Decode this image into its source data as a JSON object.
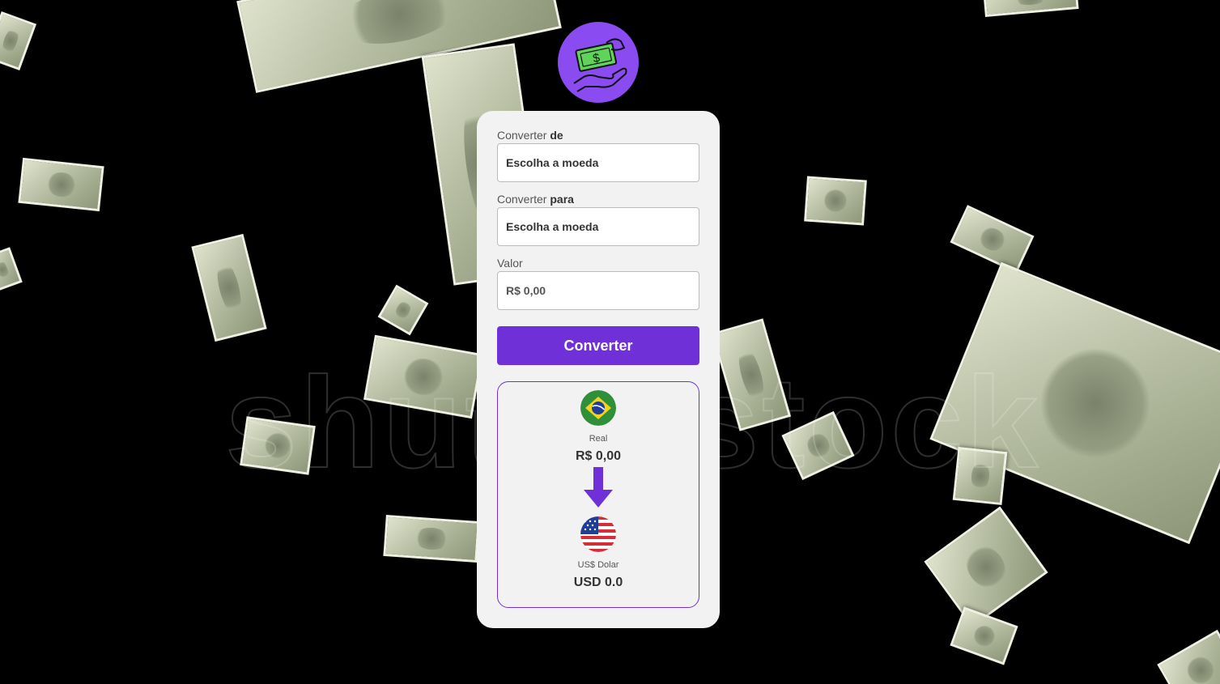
{
  "background": {
    "watermark_text": "shutterstock"
  },
  "logo": {
    "icon": "money-hand-icon",
    "color": "#8a4bf0"
  },
  "form": {
    "from": {
      "label_prefix": "Converter",
      "label_bold": "de",
      "value": "Escolha a moeda"
    },
    "to": {
      "label_prefix": "Converter",
      "label_bold": "para",
      "value": "Escolha a moeda"
    },
    "amount": {
      "label": "Valor",
      "placeholder": "R$ 0,00"
    },
    "convert_button": "Converter"
  },
  "result": {
    "from_currency": {
      "flag": "brazil-flag-icon",
      "name": "Real",
      "value": "R$ 0,00"
    },
    "to_currency": {
      "flag": "usa-flag-icon",
      "name": "US$ Dolar",
      "value": "USD 0.0"
    },
    "arrow_color": "#7030d8"
  },
  "accent_color": "#7030d8"
}
